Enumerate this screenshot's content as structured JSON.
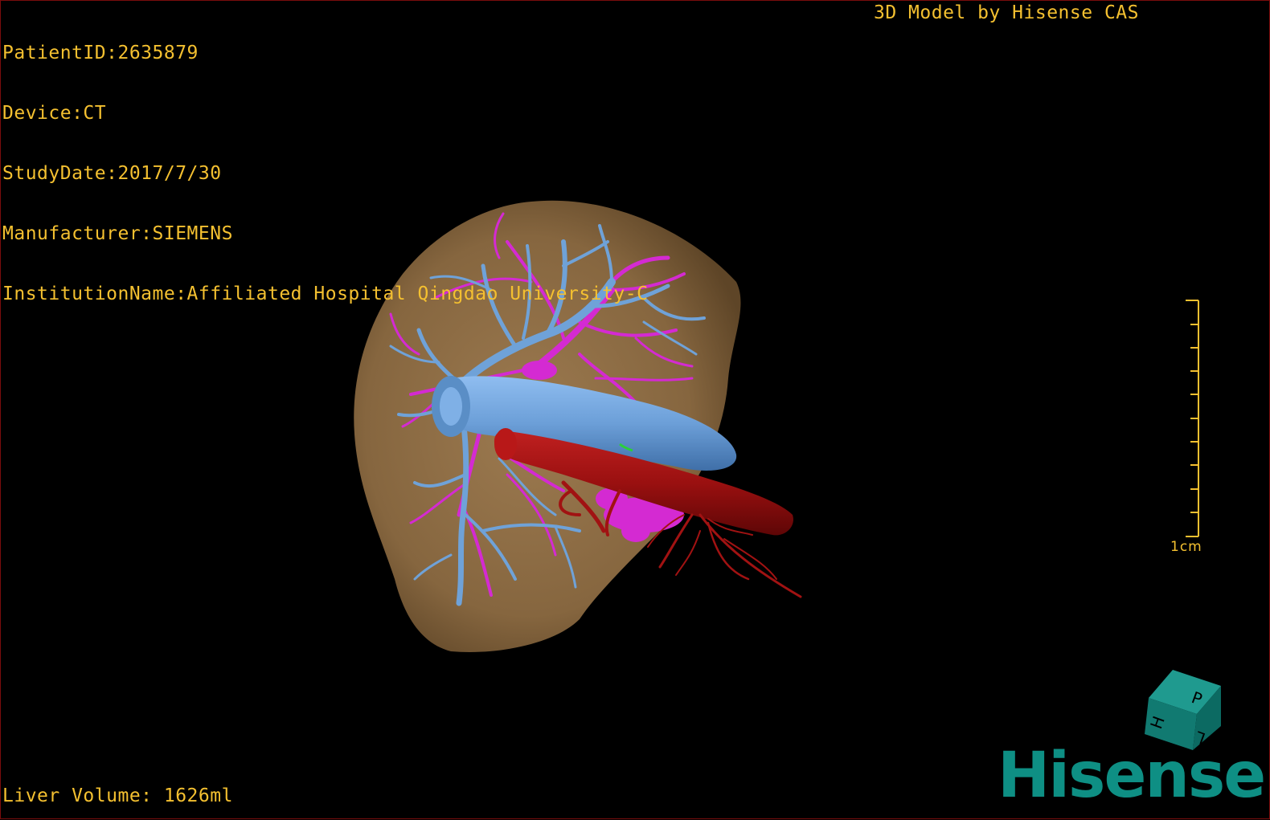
{
  "overlay": {
    "patient_id": "PatientID:2635879",
    "device": "Device:CT",
    "study_date": "StudyDate:2017/7/30",
    "manufacturer": "Manufacturer:SIEMENS",
    "institution": "InstitutionName:Affiliated Hospital Qingdao University-C",
    "model_credit": "3D Model by Hisense CAS",
    "liver_volume": "Liver Volume: 1626ml"
  },
  "scale": {
    "label": "1cm"
  },
  "orientation_cube": {
    "faces": [
      "P",
      "H",
      "L"
    ]
  },
  "logo": {
    "text": "Hisense"
  },
  "colors": {
    "overlay_text": "#f4c030",
    "liver": "#8b6a44",
    "hepatic_vein": "#6fa2d8",
    "portal_vein": "#d42ad2",
    "artery": "#a11212",
    "biliary": "#2bcf3a",
    "brand": "#0e8f84"
  },
  "icons": {
    "orientation": "orientation-cube-icon",
    "logo": "hisense-logo"
  }
}
